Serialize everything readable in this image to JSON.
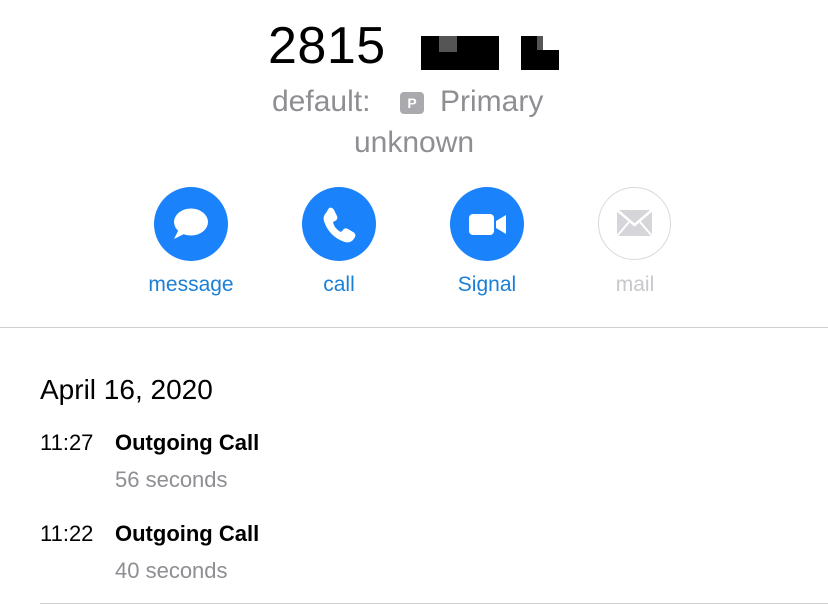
{
  "contact": {
    "number_visible": "2815",
    "label_prefix": "default:",
    "account_badge": "P",
    "account_name": "Primary",
    "name": "unknown"
  },
  "actions": [
    {
      "label": "message",
      "icon": "message-bubble-icon",
      "enabled": true
    },
    {
      "label": "call",
      "icon": "phone-icon",
      "enabled": true
    },
    {
      "label": "Signal",
      "icon": "video-camera-icon",
      "enabled": true
    },
    {
      "label": "mail",
      "icon": "envelope-icon",
      "enabled": false
    }
  ],
  "history": {
    "date": "April 16, 2020",
    "calls": [
      {
        "time": "11:27",
        "type": "Outgoing Call",
        "duration": "56 seconds"
      },
      {
        "time": "11:22",
        "type": "Outgoing Call",
        "duration": "40 seconds"
      }
    ]
  },
  "colors": {
    "accent": "#1a82fb",
    "label_blue": "#1a7fd6",
    "secondary_text": "#8e8e93",
    "disabled": "#c8c8cc"
  }
}
